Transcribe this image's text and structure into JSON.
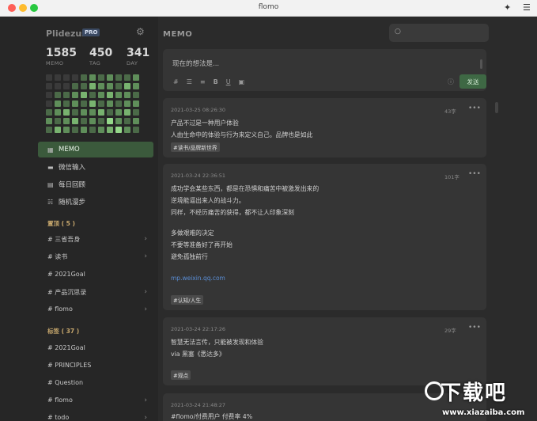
{
  "window": {
    "title": "flomo"
  },
  "sidebar": {
    "brand": "Plidezus",
    "pro_badge": "PRO",
    "stats": [
      {
        "value": "1585",
        "label": "MEMO"
      },
      {
        "value": "450",
        "label": "TAG"
      },
      {
        "value": "341",
        "label": "DAY"
      }
    ],
    "nav": [
      {
        "label": "MEMO",
        "icon": "grid-icon"
      },
      {
        "label": "微信输入",
        "icon": "chat-icon"
      },
      {
        "label": "每日回顾",
        "icon": "calendar-icon"
      },
      {
        "label": "随机漫步",
        "icon": "shuffle-icon"
      }
    ],
    "pinned_title": "置顶 ( 5 )",
    "pinned": [
      {
        "label": "# 三省吾身",
        "chevron": true
      },
      {
        "label": "# 读书",
        "chevron": true
      },
      {
        "label": "# 2021Goal",
        "chevron": false
      },
      {
        "label": "# 产品沉思录",
        "chevron": true
      },
      {
        "label": "# flomo",
        "chevron": true
      }
    ],
    "tags_title": "标签 ( 37 )",
    "tags": [
      {
        "label": "# 2021Goal",
        "chevron": false
      },
      {
        "label": "# PRINCIPLES",
        "chevron": false
      },
      {
        "label": "# Question",
        "chevron": false
      },
      {
        "label": "# flomo",
        "chevron": true
      },
      {
        "label": "# todo",
        "chevron": true
      }
    ]
  },
  "main": {
    "title": "MEMO",
    "editor": {
      "placeholder": "现在的想法是...",
      "send_label": "发送"
    },
    "cards": [
      {
        "time": "2021-03-25 08:26:30",
        "count": "43字",
        "lines": [
          "产品不过是一种用户体验",
          "人由生命中的体验与行为来定义自己。品牌也是如此"
        ],
        "tag": "#读书/品牌新世界"
      },
      {
        "time": "2021-03-24 22:36:51",
        "count": "101字",
        "lines": [
          "成功学会某些东西，都是在恐惧和痛苦中被激发出来的",
          "逆境能逼出来人的战斗力。",
          "同样，不经历痛苦的获得，都不让人印象深刻",
          "",
          "多做艰难的决定",
          "不要等准备好了再开始",
          "避免孤独前行"
        ],
        "link": "mp.weixin.qq.com",
        "tag": "#认知/人生"
      },
      {
        "time": "2021-03-24 22:17:26",
        "count": "29字",
        "lines": [
          "智慧无法言传，只能被发现和体验",
          "via 黑塞《悉达多》"
        ],
        "tag": "#观点"
      },
      {
        "time": "2021-03-24 21:48:27",
        "count": "",
        "lines": [
          "#flomo/付费用户 付费率 4%"
        ],
        "tag": ""
      }
    ]
  },
  "watermark": {
    "main": "下载吧",
    "sub": "www.xiazaiba.com"
  },
  "colors": {
    "accent": "#3e6844",
    "active_nav": "#3b5a3c",
    "link": "#5a8ed6"
  }
}
